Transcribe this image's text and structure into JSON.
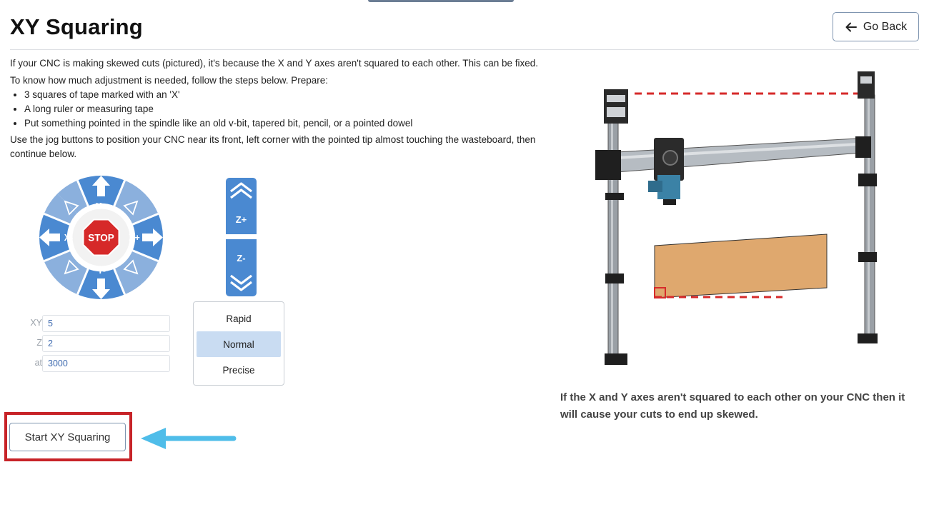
{
  "page": {
    "title": "XY Squaring",
    "go_back_label": "Go Back"
  },
  "intro": {
    "line1": "If your CNC is making skewed cuts (pictured), it's because the X and Y axes aren't squared to each other. This can be fixed.",
    "line2": "To know how much adjustment is needed, follow the steps below. Prepare:",
    "prepare_items": [
      "3 squares of tape marked with an 'X'",
      "A long ruler or measuring tape",
      "Put something pointed in the spindle like an old v-bit, tapered bit, pencil, or a pointed dowel"
    ],
    "line3": "Use the jog buttons to position your CNC near its front, left corner with the pointed tip almost touching the wasteboard, then continue below."
  },
  "jog": {
    "y_plus": "Y+",
    "y_minus": "Y-",
    "x_plus": "X+",
    "x_minus": "X-",
    "stop": "STOP",
    "z_plus": "Z+",
    "z_minus": "Z-"
  },
  "inputs": {
    "xy_label": "XY",
    "xy_value": "5",
    "z_label": "Z",
    "z_value": "2",
    "at_label": "at",
    "at_value": "3000"
  },
  "speed": {
    "options": [
      "Rapid",
      "Normal",
      "Precise"
    ],
    "selected": "Normal"
  },
  "start_button_label": "Start XY Squaring",
  "caption": "If the X and Y axes aren't squared to each other on your CNC then it will cause your cuts to end up skewed.",
  "colors": {
    "jog_blue": "#4a89d1",
    "jog_light_blue": "#8bb0dd",
    "stop_red": "#d62929",
    "highlight_red": "#c72328",
    "pointer_blue": "#4fbde9",
    "selected_bg": "#c9dcf2",
    "wood": "#dfa86e",
    "skew_line": "#d62a2a"
  }
}
